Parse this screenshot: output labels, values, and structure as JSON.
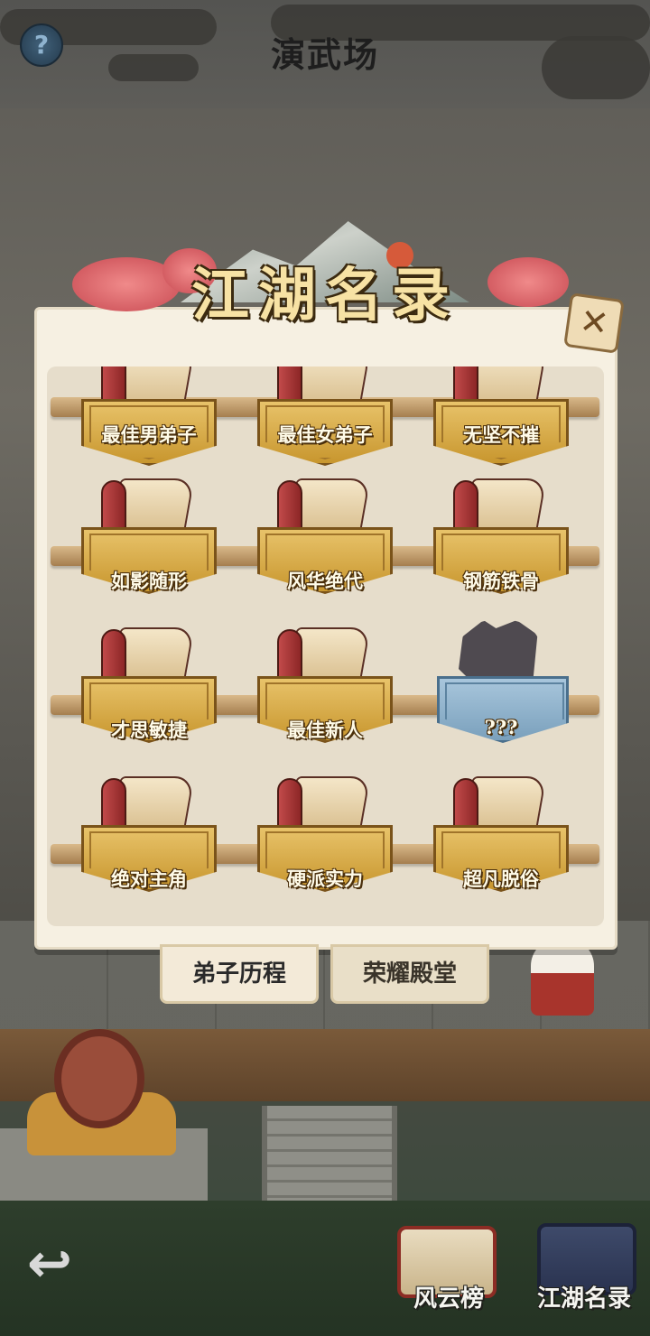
{
  "header": {
    "help_icon": "question-mark-icon",
    "help_label": "?",
    "title": "演武场"
  },
  "panel": {
    "banner_title": "江湖名录",
    "close_icon": "close-x-icon",
    "close_label": "✕",
    "top_row": [
      "最佳男弟子",
      "最佳女弟子",
      "无坚不摧"
    ],
    "rows": [
      [
        "如影随形",
        "风华绝代",
        "钢筋铁骨"
      ],
      [
        "才思敏捷",
        "最佳新人",
        "???"
      ],
      [
        "绝对主角",
        "硬派实力",
        "超凡脱俗"
      ]
    ]
  },
  "tabs": {
    "history": "弟子历程",
    "hall_of_fame": "荣耀殿堂"
  },
  "bottom_nav": {
    "back_icon": "back-arrow-icon",
    "back_label": "↩",
    "ranking_label": "风云榜",
    "ranking_icon": "ranking-scroll-icon",
    "directory_label": "江湖名录",
    "directory_icon": "book-icon"
  },
  "colors": {
    "plaque_gold": "#d8a845",
    "plaque_locked": "#8fb1cb",
    "panel_bg": "#f6f0e2",
    "banner_text": "#f7e2a4"
  }
}
